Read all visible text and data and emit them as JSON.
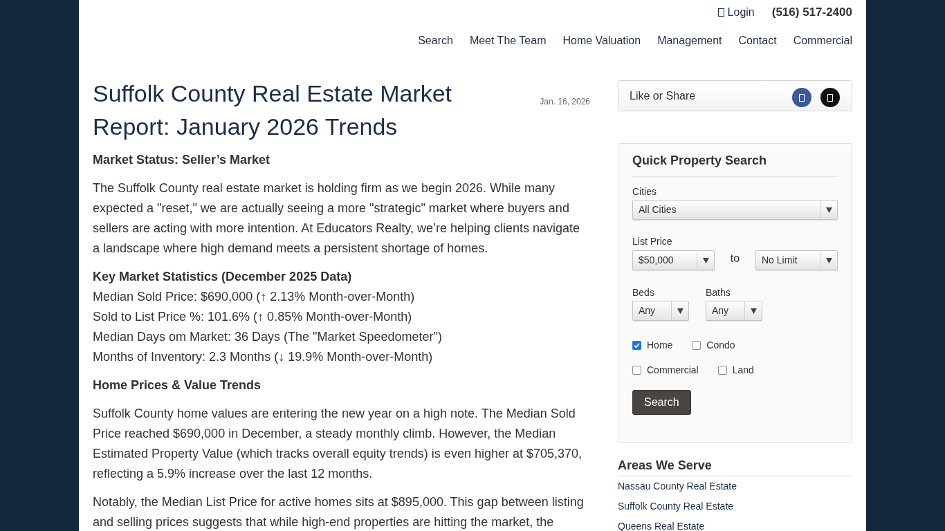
{
  "header": {
    "login": "Login",
    "phone": "(516) 517-2400"
  },
  "nav": [
    "Search",
    "Meet The Team",
    "Home Valuation",
    "Management",
    "Contact",
    "Commercial"
  ],
  "article": {
    "title": "Suffolk County Real Estate Market Report: January 2026 Trends",
    "date": "Jan. 16, 2026",
    "blocks": [
      {
        "kind": "heading",
        "text": "Market Status: Seller’s Market"
      },
      {
        "kind": "paragraph",
        "text": "The Suffolk County real estate market is holding firm as we begin 2026. While many expected a \"reset,\" we are actually seeing a more \"strategic\" market where buyers and sellers are acting with more intention. At Educators Realty, we’re helping clients navigate a landscape where high demand meets a persistent shortage of homes."
      },
      {
        "kind": "list",
        "heading": "Key Market Statistics (December 2025 Data)",
        "lines": [
          "Median Sold Price: $690,000 (↑ 2.13% Month-over-Month)",
          "Sold to List Price %: 101.6% (↑ 0.85% Month-over-Month)",
          "Median Days om Market: 36 Days (The \"Market Speedometer\")",
          "Months of Inventory: 2.3 Months (↓ 19.9% Month-over-Month)"
        ]
      },
      {
        "kind": "heading",
        "text": "Home Prices & Value Trends"
      },
      {
        "kind": "paragraph",
        "text": "Suffolk County home values are entering the new year on a high note. The Median Sold Price reached $690,000 in December, a steady monthly climb. However, the Median Estimated Property Value (which tracks overall equity trends) is even higher at $705,370, reflecting a 5.9% increase over the last 12 months."
      },
      {
        "kind": "paragraph",
        "text": "Notably, the Median List Price for active homes sits at $895,000. This gap between listing and selling prices suggests that while high-end properties are hitting the market, the"
      }
    ]
  },
  "sidebar": {
    "share": {
      "label": "Like or Share",
      "buttons": [
        {
          "color": "#3b5998"
        },
        {
          "color": "#111111"
        }
      ]
    },
    "quick_search": {
      "title": "Quick Property Search",
      "cities": {
        "label": "Cities",
        "value": "All Cities"
      },
      "list_price": {
        "label": "List Price",
        "min": "$50,000",
        "separator": "to",
        "max": "No Limit"
      },
      "beds": {
        "label": "Beds",
        "value": "Any"
      },
      "baths": {
        "label": "Baths",
        "value": "Any"
      },
      "property_types": [
        {
          "label": "Home",
          "checked": true
        },
        {
          "label": "Condo",
          "checked": false
        },
        {
          "label": "Commercial",
          "checked": false
        },
        {
          "label": "Land",
          "checked": false
        }
      ],
      "button": "Search"
    },
    "areas": {
      "title": "Areas We Serve",
      "links": [
        "Nassau County Real Estate",
        "Suffolk County Real Estate",
        "Queens Real Estate"
      ]
    }
  }
}
